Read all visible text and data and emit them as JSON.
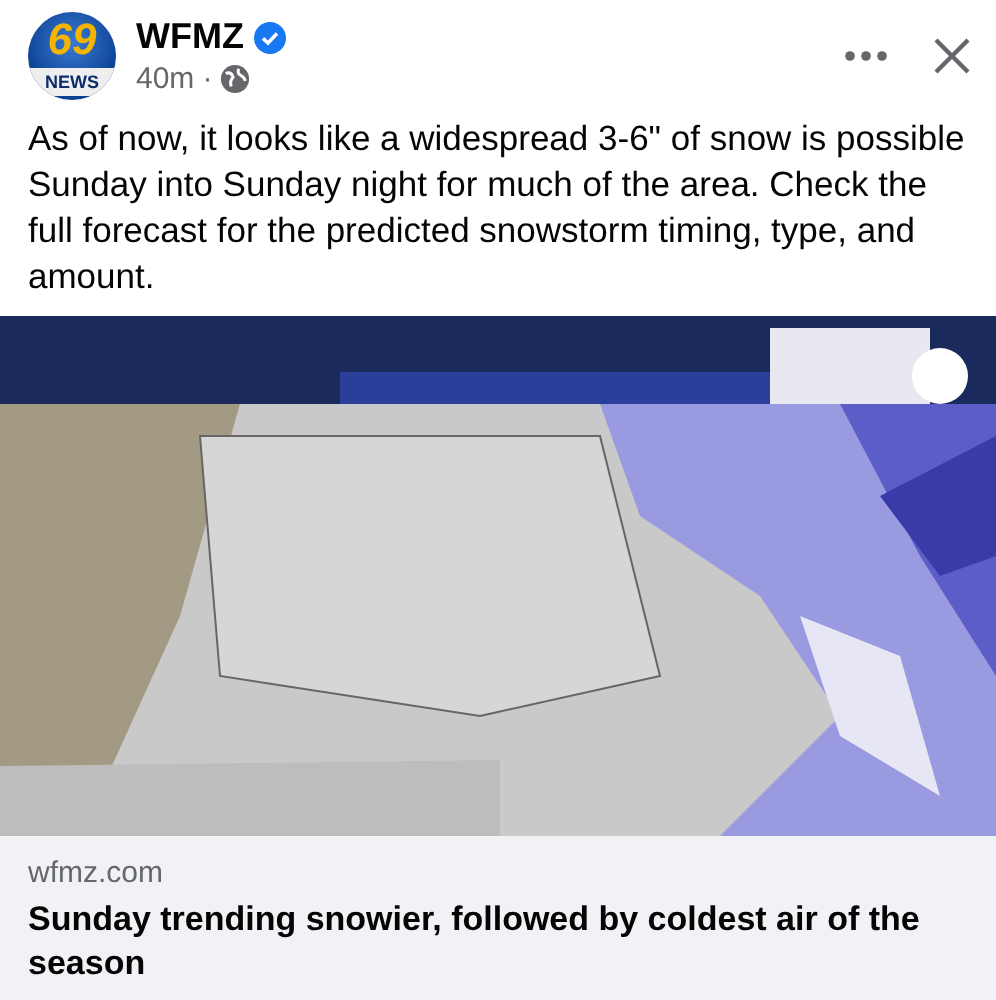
{
  "avatar": {
    "number": "69",
    "caption": "NEWS"
  },
  "author": {
    "name": "WFMZ",
    "verified": true
  },
  "meta": {
    "time": "40m",
    "separator": "·"
  },
  "post_text": "As of now, it looks like a widespread 3-6\" of snow is possible Sunday into Sunday night for much of the area. Check the full forecast for the predicted snowstorm timing, type, and amount.",
  "attachment": {
    "domain": "wfmz.com",
    "title": "Sunday trending snowier, followed by coldest air of the season"
  }
}
